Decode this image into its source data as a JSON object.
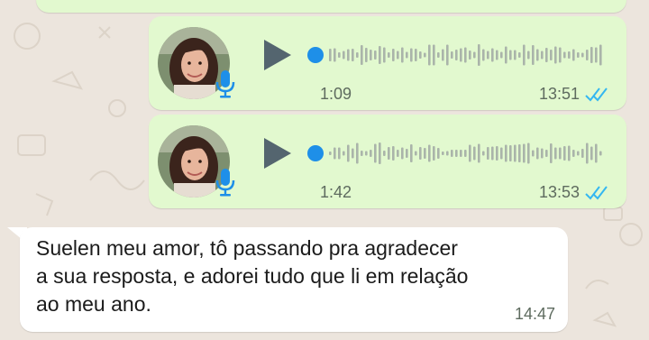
{
  "colors": {
    "wallpaper": "#ece5dd",
    "outgoing_bubble": "#e2f9cf",
    "incoming_bubble": "#ffffff",
    "played_dot": "#1e8fe8",
    "read_ticks": "#34b7f1",
    "mic": "#1e8fe8",
    "play_icon": "#54656f",
    "wave": "#aab4aa"
  },
  "audio_messages": [
    {
      "duration": "1:09",
      "time": "13:51",
      "status_icon": "double-check-read-icon",
      "avatar": "profile-photo"
    },
    {
      "duration": "1:42",
      "time": "13:53",
      "status_icon": "double-check-read-icon",
      "avatar": "profile-photo"
    }
  ],
  "text_message": {
    "text": "Suelen meu amor, tô passando pra agradecer\na sua resposta, e adorei tudo que li em relação\nao meu ano.",
    "time": "14:47"
  }
}
